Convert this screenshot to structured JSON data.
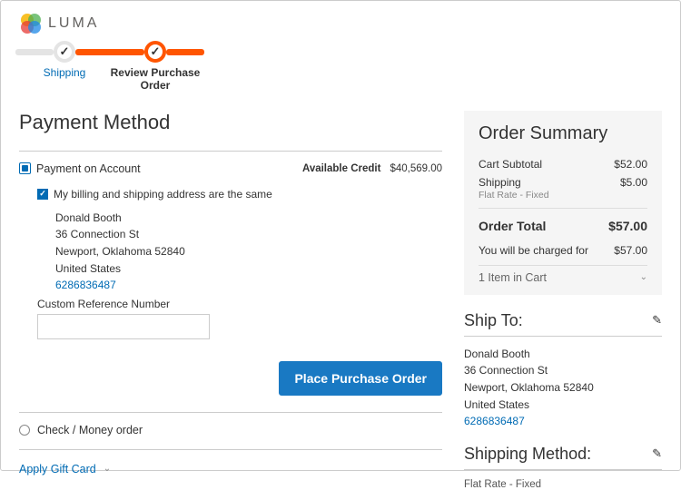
{
  "brand": {
    "name": "LUMA"
  },
  "progress": {
    "step1_label": "Shipping",
    "step2_label": "Review Purchase Order",
    "check": "✓"
  },
  "payment": {
    "title": "Payment Method",
    "accountOption": "Payment on Account",
    "availableLabel": "Available Credit",
    "availableValue": "$40,569.00",
    "sameAddress": "My billing and shipping address are the same",
    "address": {
      "name": "Donald Booth",
      "street": "36 Connection St",
      "cityline": "Newport, Oklahoma 52840",
      "country": "United States",
      "phone": "6286836487"
    },
    "refLabel": "Custom Reference Number",
    "placeButton": "Place Purchase Order",
    "checkMoney": "Check / Money order",
    "giftCard": "Apply Gift Card"
  },
  "summary": {
    "title": "Order Summary",
    "subtotalLabel": "Cart Subtotal",
    "subtotalValue": "$52.00",
    "shippingLabel": "Shipping",
    "shippingSub": "Flat Rate - Fixed",
    "shippingValue": "$5.00",
    "totalLabel": "Order Total",
    "totalValue": "$57.00",
    "chargedLabel": "You will be charged for",
    "chargedValue": "$57.00",
    "cartItems": "1 Item in Cart"
  },
  "shipTo": {
    "title": "Ship To:",
    "address": {
      "name": "Donald Booth",
      "street": "36 Connection St",
      "cityline": "Newport, Oklahoma 52840",
      "country": "United States",
      "phone": "6286836487"
    }
  },
  "shipMethod": {
    "title": "Shipping Method:",
    "value": "Flat Rate - Fixed"
  }
}
